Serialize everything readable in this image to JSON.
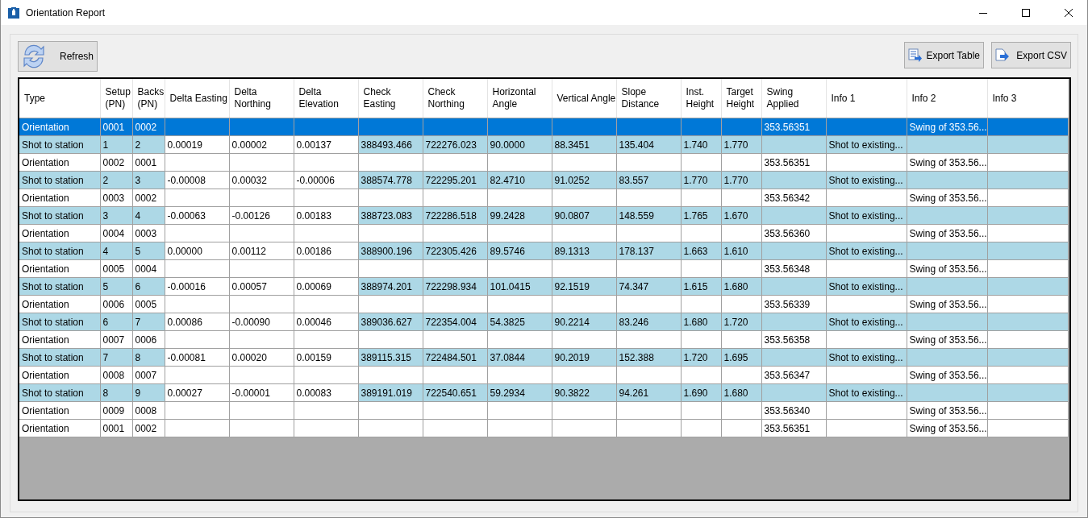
{
  "window": {
    "title": "Orientation Report"
  },
  "toolbar": {
    "left": [
      {
        "label": "Refresh",
        "kind": "refresh"
      }
    ],
    "right": [
      {
        "label": "Export Table",
        "kind": "table"
      },
      {
        "label": "Export CSV",
        "kind": "csv"
      }
    ]
  },
  "table": {
    "columns": [
      {
        "label": "Type",
        "kind": "value"
      },
      {
        "label": "Setup (PN)",
        "kind": "value"
      },
      {
        "label": "Backs (PN)",
        "kind": "value"
      },
      {
        "label": "Delta Easting",
        "kind": "delta"
      },
      {
        "label": "Delta Northing",
        "kind": "delta"
      },
      {
        "label": "Delta Elevation",
        "kind": "delta"
      },
      {
        "label": "Check Easting",
        "kind": "value"
      },
      {
        "label": "Check Northing",
        "kind": "value"
      },
      {
        "label": "Horizontal Angle",
        "kind": "value"
      },
      {
        "label": "Vertical Angle",
        "kind": "value"
      },
      {
        "label": "Slope Distance",
        "kind": "value"
      },
      {
        "label": "Inst. Height",
        "kind": "value"
      },
      {
        "label": "Target Height",
        "kind": "value"
      },
      {
        "label": "Swing Applied",
        "kind": "value"
      },
      {
        "label": "Info 1",
        "kind": "value"
      },
      {
        "label": "Info 2",
        "kind": "value"
      },
      {
        "label": "Info 3",
        "kind": "value"
      }
    ],
    "rows": [
      {
        "kind": "orientation",
        "selected": true,
        "cells": [
          "Orientation",
          "0001",
          "0002",
          null,
          null,
          null,
          null,
          null,
          null,
          null,
          null,
          null,
          null,
          "353.56351",
          null,
          "Swing of 353.56...",
          null
        ]
      },
      {
        "kind": "shot",
        "selected": false,
        "cells": [
          "Shot to station",
          "1",
          "2",
          "0.00019",
          "0.00002",
          "0.00137",
          "388493.466",
          "722276.023",
          "90.0000",
          "88.3451",
          "135.404",
          "1.740",
          "1.770",
          null,
          "Shot to existing...",
          null,
          null
        ]
      },
      {
        "kind": "orientation",
        "selected": false,
        "cells": [
          "Orientation",
          "0002",
          "0001",
          null,
          null,
          null,
          null,
          null,
          null,
          null,
          null,
          null,
          null,
          "353.56351",
          null,
          "Swing of 353.56...",
          null
        ]
      },
      {
        "kind": "shot",
        "selected": false,
        "cells": [
          "Shot to station",
          "2",
          "3",
          "-0.00008",
          "0.00032",
          "-0.00006",
          "388574.778",
          "722295.201",
          "82.4710",
          "91.0252",
          "83.557",
          "1.770",
          "1.770",
          null,
          "Shot to existing...",
          null,
          null
        ]
      },
      {
        "kind": "orientation",
        "selected": false,
        "cells": [
          "Orientation",
          "0003",
          "0002",
          null,
          null,
          null,
          null,
          null,
          null,
          null,
          null,
          null,
          null,
          "353.56342",
          null,
          "Swing of 353.56...",
          null
        ]
      },
      {
        "kind": "shot",
        "selected": false,
        "cells": [
          "Shot to station",
          "3",
          "4",
          "-0.00063",
          "-0.00126",
          "0.00183",
          "388723.083",
          "722286.518",
          "99.2428",
          "90.0807",
          "148.559",
          "1.765",
          "1.670",
          null,
          "Shot to existing...",
          null,
          null
        ]
      },
      {
        "kind": "orientation",
        "selected": false,
        "cells": [
          "Orientation",
          "0004",
          "0003",
          null,
          null,
          null,
          null,
          null,
          null,
          null,
          null,
          null,
          null,
          "353.56360",
          null,
          "Swing of 353.56...",
          null
        ]
      },
      {
        "kind": "shot",
        "selected": false,
        "cells": [
          "Shot to station",
          "4",
          "5",
          "0.00000",
          "0.00112",
          "0.00186",
          "388900.196",
          "722305.426",
          "89.5746",
          "89.1313",
          "178.137",
          "1.663",
          "1.610",
          null,
          "Shot to existing...",
          null,
          null
        ]
      },
      {
        "kind": "orientation",
        "selected": false,
        "cells": [
          "Orientation",
          "0005",
          "0004",
          null,
          null,
          null,
          null,
          null,
          null,
          null,
          null,
          null,
          null,
          "353.56348",
          null,
          "Swing of 353.56...",
          null
        ]
      },
      {
        "kind": "shot",
        "selected": false,
        "cells": [
          "Shot to station",
          "5",
          "6",
          "-0.00016",
          "0.00057",
          "0.00069",
          "388974.201",
          "722298.934",
          "101.0415",
          "92.1519",
          "74.347",
          "1.615",
          "1.680",
          null,
          "Shot to existing...",
          null,
          null
        ]
      },
      {
        "kind": "orientation",
        "selected": false,
        "cells": [
          "Orientation",
          "0006",
          "0005",
          null,
          null,
          null,
          null,
          null,
          null,
          null,
          null,
          null,
          null,
          "353.56339",
          null,
          "Swing of 353.56...",
          null
        ]
      },
      {
        "kind": "shot",
        "selected": false,
        "cells": [
          "Shot to station",
          "6",
          "7",
          "0.00086",
          "-0.00090",
          "0.00046",
          "389036.627",
          "722354.004",
          "54.3825",
          "90.2214",
          "83.246",
          "1.680",
          "1.720",
          null,
          "Shot to existing...",
          null,
          null
        ]
      },
      {
        "kind": "orientation",
        "selected": false,
        "cells": [
          "Orientation",
          "0007",
          "0006",
          null,
          null,
          null,
          null,
          null,
          null,
          null,
          null,
          null,
          null,
          "353.56358",
          null,
          "Swing of 353.56...",
          null
        ]
      },
      {
        "kind": "shot",
        "selected": false,
        "cells": [
          "Shot to station",
          "7",
          "8",
          "-0.00081",
          "0.00020",
          "0.00159",
          "389115.315",
          "722484.501",
          "37.0844",
          "90.2019",
          "152.388",
          "1.720",
          "1.695",
          null,
          "Shot to existing...",
          null,
          null
        ]
      },
      {
        "kind": "orientation",
        "selected": false,
        "cells": [
          "Orientation",
          "0008",
          "0007",
          null,
          null,
          null,
          null,
          null,
          null,
          null,
          null,
          null,
          null,
          "353.56347",
          null,
          "Swing of 353.56...",
          null
        ]
      },
      {
        "kind": "shot",
        "selected": false,
        "cells": [
          "Shot to station",
          "8",
          "9",
          "0.00027",
          "-0.00001",
          "0.00083",
          "389191.019",
          "722540.651",
          "59.2934",
          "90.3822",
          "94.261",
          "1.690",
          "1.680",
          null,
          "Shot to existing...",
          null,
          null
        ]
      },
      {
        "kind": "orientation",
        "selected": false,
        "cells": [
          "Orientation",
          "0009",
          "0008",
          null,
          null,
          null,
          null,
          null,
          null,
          null,
          null,
          null,
          null,
          "353.56340",
          null,
          "Swing of 353.56...",
          null
        ]
      },
      {
        "kind": "orientation",
        "selected": false,
        "cells": [
          "Orientation",
          "0001",
          "0002",
          null,
          null,
          null,
          null,
          null,
          null,
          null,
          null,
          null,
          null,
          "353.56351",
          null,
          "Swing of 353.56...",
          null
        ]
      }
    ]
  }
}
